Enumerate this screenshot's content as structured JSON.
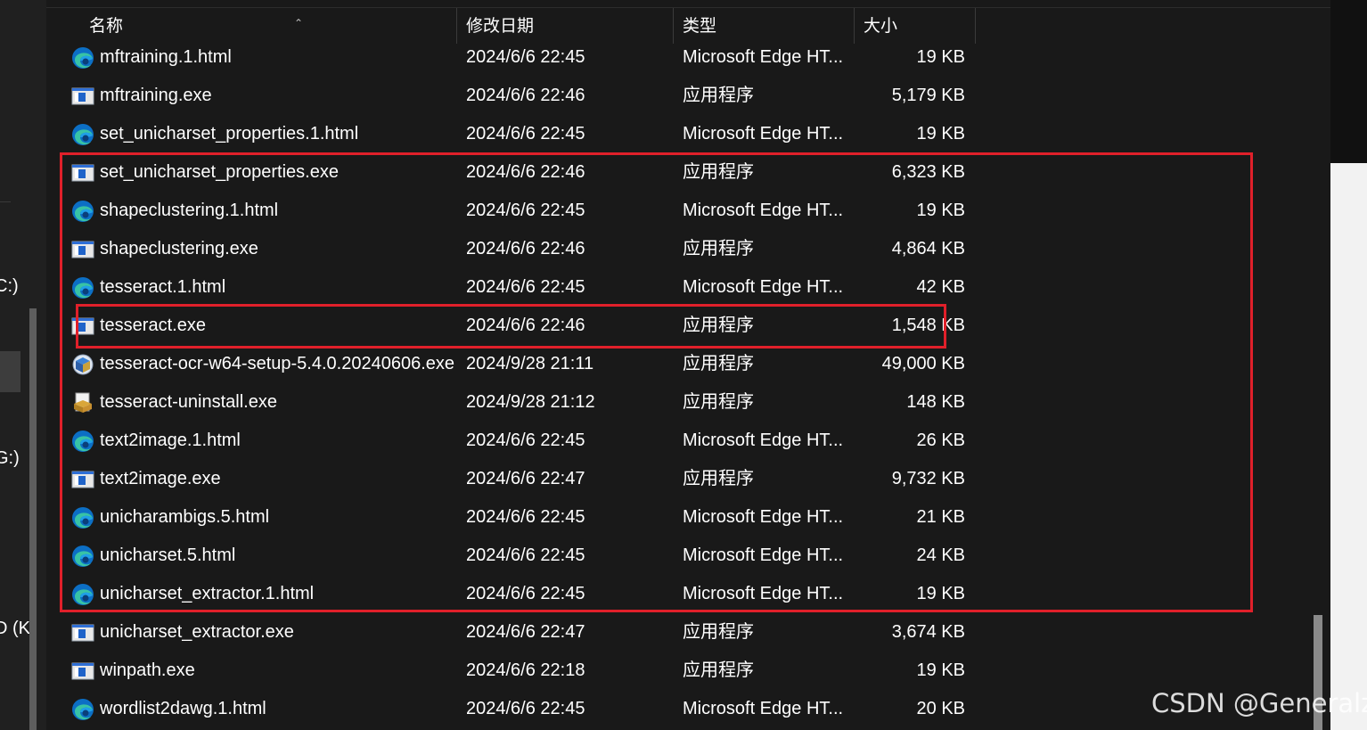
{
  "columns": {
    "name": "名称",
    "date": "修改日期",
    "type": "类型",
    "size": "大小"
  },
  "sidebar": {
    "drive_labels": [
      "C:)",
      "G:)",
      "D (K"
    ]
  },
  "files": [
    {
      "name": "mftraining.1.html",
      "date": "2024/6/6 22:45",
      "type": "Microsoft Edge HT...",
      "size": "19 KB",
      "icon": "edge-icon"
    },
    {
      "name": "mftraining.exe",
      "date": "2024/6/6 22:46",
      "type": "应用程序",
      "size": "5,179 KB",
      "icon": "exe-icon"
    },
    {
      "name": "set_unicharset_properties.1.html",
      "date": "2024/6/6 22:45",
      "type": "Microsoft Edge HT...",
      "size": "19 KB",
      "icon": "edge-icon"
    },
    {
      "name": "set_unicharset_properties.exe",
      "date": "2024/6/6 22:46",
      "type": "应用程序",
      "size": "6,323 KB",
      "icon": "exe-icon"
    },
    {
      "name": "shapeclustering.1.html",
      "date": "2024/6/6 22:45",
      "type": "Microsoft Edge HT...",
      "size": "19 KB",
      "icon": "edge-icon"
    },
    {
      "name": "shapeclustering.exe",
      "date": "2024/6/6 22:46",
      "type": "应用程序",
      "size": "4,864 KB",
      "icon": "exe-icon"
    },
    {
      "name": "tesseract.1.html",
      "date": "2024/6/6 22:45",
      "type": "Microsoft Edge HT...",
      "size": "42 KB",
      "icon": "edge-icon"
    },
    {
      "name": "tesseract.exe",
      "date": "2024/6/6 22:46",
      "type": "应用程序",
      "size": "1,548 KB",
      "icon": "exe-icon"
    },
    {
      "name": "tesseract-ocr-w64-setup-5.4.0.20240606.exe",
      "date": "2024/9/28 21:11",
      "type": "应用程序",
      "size": "49,000 KB",
      "icon": "installer-icon"
    },
    {
      "name": "tesseract-uninstall.exe",
      "date": "2024/9/28 21:12",
      "type": "应用程序",
      "size": "148 KB",
      "icon": "uninstaller-icon"
    },
    {
      "name": "text2image.1.html",
      "date": "2024/6/6 22:45",
      "type": "Microsoft Edge HT...",
      "size": "26 KB",
      "icon": "edge-icon"
    },
    {
      "name": "text2image.exe",
      "date": "2024/6/6 22:47",
      "type": "应用程序",
      "size": "9,732 KB",
      "icon": "exe-icon"
    },
    {
      "name": "unicharambigs.5.html",
      "date": "2024/6/6 22:45",
      "type": "Microsoft Edge HT...",
      "size": "21 KB",
      "icon": "edge-icon"
    },
    {
      "name": "unicharset.5.html",
      "date": "2024/6/6 22:45",
      "type": "Microsoft Edge HT...",
      "size": "24 KB",
      "icon": "edge-icon"
    },
    {
      "name": "unicharset_extractor.1.html",
      "date": "2024/6/6 22:45",
      "type": "Microsoft Edge HT...",
      "size": "19 KB",
      "icon": "edge-icon"
    },
    {
      "name": "unicharset_extractor.exe",
      "date": "2024/6/6 22:47",
      "type": "应用程序",
      "size": "3,674 KB",
      "icon": "exe-icon"
    },
    {
      "name": "winpath.exe",
      "date": "2024/6/6 22:18",
      "type": "应用程序",
      "size": "19 KB",
      "icon": "exe-icon"
    },
    {
      "name": "wordlist2dawg.1.html",
      "date": "2024/6/6 22:45",
      "type": "Microsoft Edge HT...",
      "size": "20 KB",
      "icon": "edge-icon"
    }
  ],
  "highlight_color": "#e0202a",
  "watermark": "CSDN @Generalzy"
}
